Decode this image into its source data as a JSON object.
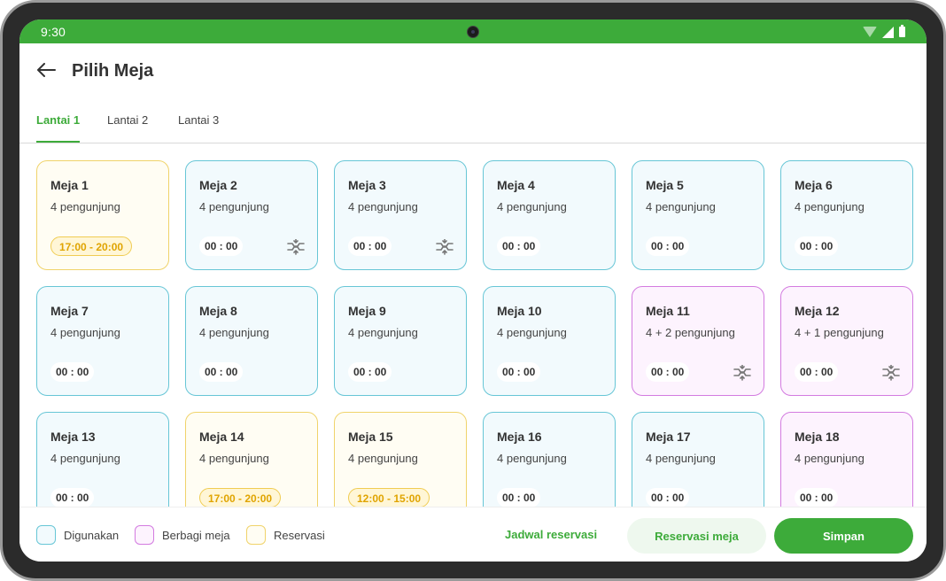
{
  "status_bar": {
    "time": "9:30"
  },
  "header": {
    "title": "Pilih Meja"
  },
  "tabs": [
    {
      "label": "Lantai 1",
      "active": true
    },
    {
      "label": "Lantai 2",
      "active": false
    },
    {
      "label": "Lantai 3",
      "active": false
    }
  ],
  "tables": [
    {
      "name": "Meja 1",
      "guests": "4 pengunjung",
      "time": "17:00 - 20:00",
      "status": "reserved",
      "merge_icon": false
    },
    {
      "name": "Meja 2",
      "guests": "4 pengunjung",
      "time": "00 : 00",
      "status": "used",
      "merge_icon": true
    },
    {
      "name": "Meja 3",
      "guests": "4 pengunjung",
      "time": "00 : 00",
      "status": "used",
      "merge_icon": true
    },
    {
      "name": "Meja 4",
      "guests": "4 pengunjung",
      "time": "00 : 00",
      "status": "used",
      "merge_icon": false
    },
    {
      "name": "Meja 5",
      "guests": "4 pengunjung",
      "time": "00 : 00",
      "status": "used",
      "merge_icon": false
    },
    {
      "name": "Meja 6",
      "guests": "4 pengunjung",
      "time": "00 : 00",
      "status": "used",
      "merge_icon": false
    },
    {
      "name": "Meja 7",
      "guests": "4 pengunjung",
      "time": "00 : 00",
      "status": "used",
      "merge_icon": false
    },
    {
      "name": "Meja 8",
      "guests": "4 pengunjung",
      "time": "00 : 00",
      "status": "used",
      "merge_icon": false
    },
    {
      "name": "Meja 9",
      "guests": "4 pengunjung",
      "time": "00 : 00",
      "status": "used",
      "merge_icon": false
    },
    {
      "name": "Meja 10",
      "guests": "4 pengunjung",
      "time": "00 : 00",
      "status": "used",
      "merge_icon": false
    },
    {
      "name": "Meja 11",
      "guests": "4 + 2  pengunjung",
      "time": "00 : 00",
      "status": "shared",
      "merge_icon": true
    },
    {
      "name": "Meja 12",
      "guests": "4 + 1  pengunjung",
      "time": "00 : 00",
      "status": "shared",
      "merge_icon": true
    },
    {
      "name": "Meja 13",
      "guests": "4 pengunjung",
      "time": "00 : 00",
      "status": "used",
      "merge_icon": false
    },
    {
      "name": "Meja 14",
      "guests": "4 pengunjung",
      "time": "17:00 - 20:00",
      "status": "reserved",
      "merge_icon": false
    },
    {
      "name": "Meja 15",
      "guests": "4 pengunjung",
      "time": "12:00 - 15:00",
      "status": "reserved",
      "merge_icon": false
    },
    {
      "name": "Meja 16",
      "guests": "4 pengunjung",
      "time": "00 : 00",
      "status": "used",
      "merge_icon": false
    },
    {
      "name": "Meja 17",
      "guests": "4 pengunjung",
      "time": "00 : 00",
      "status": "used",
      "merge_icon": false
    },
    {
      "name": "Meja 18",
      "guests": "4 pengunjung",
      "time": "00 : 00",
      "status": "shared",
      "merge_icon": false
    }
  ],
  "legend": [
    {
      "label": "Digunakan",
      "status": "used"
    },
    {
      "label": "Berbagi meja",
      "status": "shared"
    },
    {
      "label": "Reservasi",
      "status": "reserved"
    }
  ],
  "footer": {
    "schedule_label": "Jadwal reservasi",
    "reserve_label": "Reservasi meja",
    "save_label": "Simpan"
  },
  "colors": {
    "primary": "#3dab3a",
    "used_border": "#67c6d6",
    "used_fill": "#f2fafd",
    "shared_border": "#d37be0",
    "shared_fill": "#fdf3fe",
    "reserved_border": "#f0d36a",
    "reserved_fill": "#fffdf3"
  },
  "icons": {
    "back": "arrow-left-icon",
    "merge": "merge-arrows-icon",
    "wifi": "wifi-icon",
    "signal": "signal-icon",
    "battery": "battery-icon"
  }
}
